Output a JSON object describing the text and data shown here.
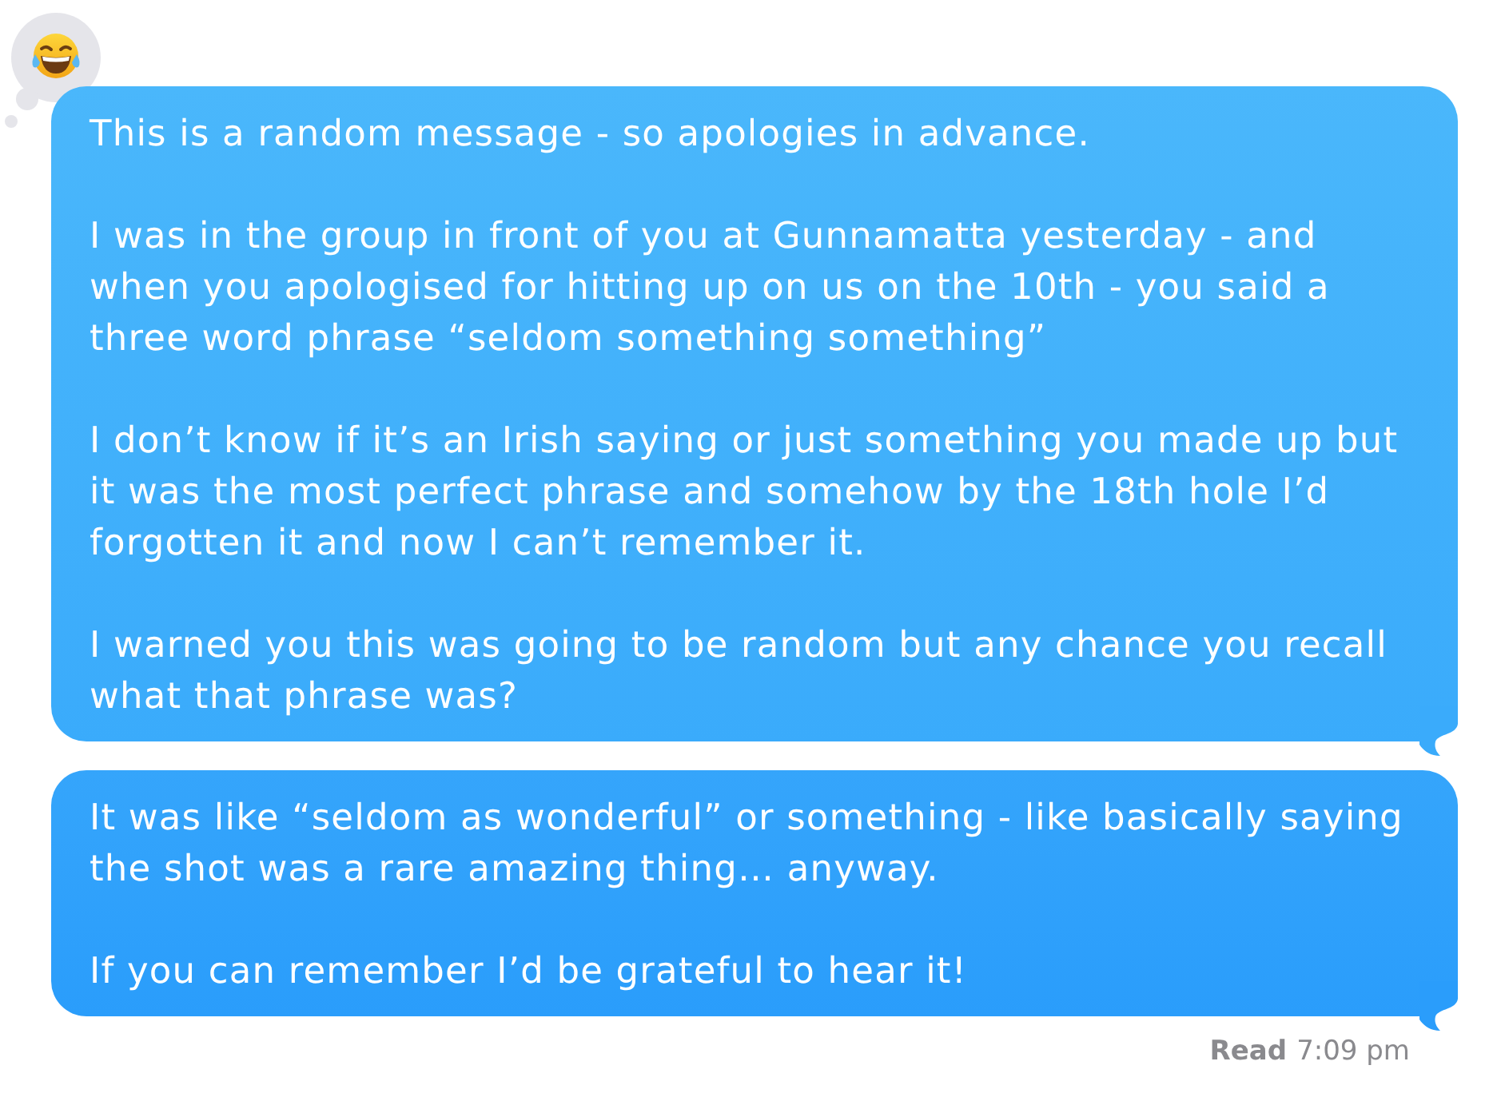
{
  "reaction": {
    "kind": "haha"
  },
  "messages": [
    {
      "tail": true,
      "paragraphs": [
        "This is a random message - so apologies in advance.",
        "I was in the group in front of you at Gunnamatta yesterday - and when you apologised for hitting up on us on the 10th - you said a three word phrase “seldom something something”",
        "I don’t know if it’s an Irish saying or just something you made up but it was the most perfect phrase and somehow by the 18th hole I’d forgotten it and now I can’t remember it.",
        "I warned you this was going to be random but any chance you recall what that phrase was?"
      ]
    },
    {
      "tail": true,
      "paragraphs": [
        "It was like “seldom as wonderful” or something - like basically saying the shot was a rare amazing thing… anyway.",
        "If you can remember I’d be grateful to hear it!"
      ]
    }
  ],
  "receipt": {
    "status": "Read",
    "time": "7:09 pm"
  }
}
